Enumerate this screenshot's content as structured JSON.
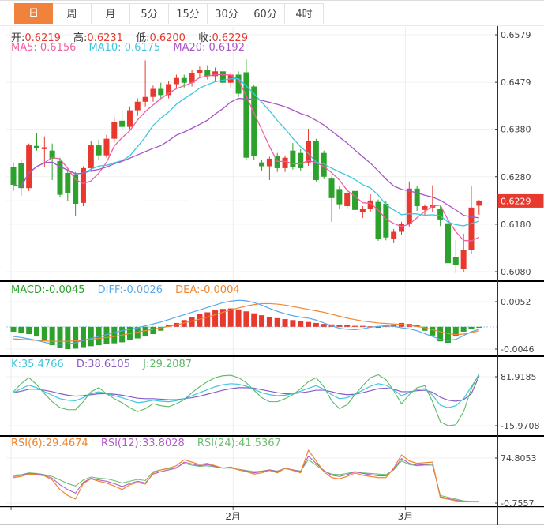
{
  "tabs": {
    "items": [
      {
        "label": "日",
        "active": true
      },
      {
        "label": "周",
        "active": false
      },
      {
        "label": "月",
        "active": false
      },
      {
        "label": "5分",
        "active": false
      },
      {
        "label": "15分",
        "active": false
      },
      {
        "label": "30分",
        "active": false
      },
      {
        "label": "60分",
        "active": false
      },
      {
        "label": "4时",
        "active": false
      }
    ]
  },
  "legend": {
    "main": {
      "open_label": "开:",
      "open_value": "0.6219",
      "high_label": "高:",
      "high_value": "0.6231",
      "low_label": "低:",
      "low_value": "0.6200",
      "close_label": "收:",
      "close_value": "0.6229",
      "ma5": "MA5: 0.6156",
      "ma10": "MA10: 0.6175",
      "ma20": "MA20: 0.6192"
    },
    "macd": {
      "macd": "MACD:-0.0045",
      "diff": "DIFF:-0.0026",
      "dea": "DEA:-0.0004"
    },
    "kdj": {
      "k": "K:35.4766",
      "d": "D:38.6105",
      "j": "J:29.2087"
    },
    "rsi": {
      "rsi6": "RSI(6):29.4674",
      "rsi12": "RSI(12):33.8028",
      "rsi24": "RSI(24):41.5367"
    }
  },
  "colors": {
    "accent_orange": "#f0823c",
    "up_red": "#e8392f",
    "down_green": "#2ca12c",
    "ma5_pink": "#f05fa0",
    "ma10_cyan": "#3ec6e0",
    "ma20_purple": "#a855c8",
    "diff_blue": "#5aa8e8",
    "dea_orange": "#f0862e",
    "k_cyan": "#3ec6e0",
    "d_purple": "#8a5cc8",
    "j_green": "#5cb866",
    "rsi6_orange": "#f0862e",
    "rsi12_purple": "#b45cc8",
    "rsi24_green": "#6cbf70",
    "grid": "#f1f1f1",
    "axis": "#333333",
    "label": "#444444",
    "price_dotted": "#f2a6a6",
    "macd_zero_dotted": "#8fd4e8"
  },
  "chart_data": {
    "type": "candlestick",
    "panels": [
      "price+MA(5,10,20)",
      "MACD(hist,DIFF,DEA)",
      "KDJ",
      "RSI(6,12,24)"
    ],
    "x_axis": {
      "month_marks": [
        {
          "label": "",
          "index": -0.3
        },
        {
          "label": "2月",
          "index": 28.3
        },
        {
          "label": "3月",
          "index": 50.5
        }
      ]
    },
    "main": {
      "y_ticks": [
        0.6579,
        0.6479,
        0.638,
        0.628,
        0.618,
        0.608
      ],
      "current_price": 0.6229,
      "current_price_label": "0.6229",
      "ma_periods": [
        5,
        10,
        20
      ],
      "candles": [
        [
          0.63,
          0.631,
          0.625,
          0.6263
        ],
        [
          0.6308,
          0.6315,
          0.624,
          0.6256
        ],
        [
          0.6256,
          0.635,
          0.625,
          0.6346
        ],
        [
          0.6345,
          0.6372,
          0.6335,
          0.634
        ],
        [
          0.6338,
          0.6365,
          0.63,
          0.6342
        ],
        [
          0.6335,
          0.635,
          0.6273,
          0.6318
        ],
        [
          0.6313,
          0.632,
          0.6238,
          0.6242
        ],
        [
          0.6288,
          0.6292,
          0.6228,
          0.6246
        ],
        [
          0.6285,
          0.629,
          0.6198,
          0.6223
        ],
        [
          0.6225,
          0.6302,
          0.6218,
          0.6298
        ],
        [
          0.6298,
          0.6355,
          0.629,
          0.6346
        ],
        [
          0.6346,
          0.6358,
          0.6315,
          0.6325
        ],
        [
          0.6325,
          0.6368,
          0.632,
          0.636
        ],
        [
          0.636,
          0.6405,
          0.6352,
          0.6395
        ],
        [
          0.6398,
          0.642,
          0.6378,
          0.6385
        ],
        [
          0.6385,
          0.6428,
          0.638,
          0.642
        ],
        [
          0.642,
          0.6445,
          0.6408,
          0.6438
        ],
        [
          0.6438,
          0.6525,
          0.6428,
          0.6448
        ],
        [
          0.6448,
          0.6472,
          0.6438,
          0.6465
        ],
        [
          0.6465,
          0.6478,
          0.6445,
          0.6452
        ],
        [
          0.6452,
          0.6482,
          0.6445,
          0.6475
        ],
        [
          0.6475,
          0.6495,
          0.6465,
          0.6488
        ],
        [
          0.6488,
          0.6495,
          0.6468,
          0.6478
        ],
        [
          0.6478,
          0.6505,
          0.647,
          0.6498
        ],
        [
          0.6498,
          0.6512,
          0.6488,
          0.6505
        ],
        [
          0.6505,
          0.6515,
          0.6485,
          0.6492
        ],
        [
          0.6492,
          0.651,
          0.6482,
          0.6502
        ],
        [
          0.6502,
          0.6508,
          0.647,
          0.6478
        ],
        [
          0.6478,
          0.65,
          0.6468,
          0.6495
        ],
        [
          0.6495,
          0.6502,
          0.6448,
          0.6455
        ],
        [
          0.65,
          0.6527,
          0.6315,
          0.632
        ],
        [
          0.647,
          0.6473,
          0.6316,
          0.6323
        ],
        [
          0.631,
          0.6315,
          0.6293,
          0.6302
        ],
        [
          0.6302,
          0.6322,
          0.6273,
          0.6318
        ],
        [
          0.6323,
          0.633,
          0.629,
          0.6298
        ],
        [
          0.6298,
          0.6325,
          0.629,
          0.632
        ],
        [
          0.6335,
          0.6351,
          0.6295,
          0.63
        ],
        [
          0.633,
          0.6338,
          0.6292,
          0.6298
        ],
        [
          0.631,
          0.6381,
          0.6303,
          0.6356
        ],
        [
          0.6356,
          0.636,
          0.627,
          0.6273
        ],
        [
          0.633,
          0.6335,
          0.6275,
          0.628
        ],
        [
          0.6276,
          0.628,
          0.6185,
          0.6235
        ],
        [
          0.6254,
          0.626,
          0.6213,
          0.6222
        ],
        [
          0.6218,
          0.625,
          0.6212,
          0.6246
        ],
        [
          0.625,
          0.6255,
          0.6164,
          0.621
        ],
        [
          0.6205,
          0.6218,
          0.6193,
          0.6213
        ],
        [
          0.6213,
          0.6243,
          0.6205,
          0.623
        ],
        [
          0.6227,
          0.6232,
          0.6145,
          0.6149
        ],
        [
          0.6223,
          0.6228,
          0.6146,
          0.6152
        ],
        [
          0.6149,
          0.617,
          0.614,
          0.6164
        ],
        [
          0.6164,
          0.6185,
          0.6158,
          0.618
        ],
        [
          0.618,
          0.627,
          0.6175,
          0.6255
        ],
        [
          0.6255,
          0.626,
          0.6208,
          0.6218
        ],
        [
          0.621,
          0.6222,
          0.6198,
          0.6218
        ],
        [
          0.6215,
          0.6262,
          0.6206,
          0.622
        ],
        [
          0.6212,
          0.6218,
          0.6176,
          0.619
        ],
        [
          0.6182,
          0.6186,
          0.6085,
          0.6098
        ],
        [
          0.611,
          0.6147,
          0.6077,
          0.6095
        ],
        [
          0.6085,
          0.616,
          0.608,
          0.6126
        ],
        [
          0.6126,
          0.626,
          0.6118,
          0.6215
        ],
        [
          0.6219,
          0.6231,
          0.62,
          0.6229
        ]
      ]
    },
    "macd": {
      "y_ticks": [
        0.0052,
        -0.0046
      ],
      "unit": 0.0001,
      "hist": [
        -10,
        -12,
        -15,
        -20,
        -28,
        -38,
        -44,
        -46,
        -45,
        -42,
        -40,
        -38,
        -36,
        -34,
        -32,
        -28,
        -24,
        -20,
        -15,
        -8,
        3,
        8,
        14,
        20,
        26,
        30,
        34,
        37,
        38,
        36,
        32,
        28,
        24,
        21,
        18,
        16,
        14,
        12,
        10,
        8,
        6,
        5,
        4,
        3,
        2,
        2,
        1,
        -2,
        3,
        5,
        8,
        6,
        3,
        -8,
        -18,
        -30,
        -33,
        -20,
        -10,
        -5,
        -2
      ],
      "diff": [
        -20,
        -22,
        -25,
        -28,
        -32,
        -35,
        -36,
        -35,
        -33,
        -28,
        -24,
        -20,
        -16,
        -12,
        -8,
        -5,
        -2,
        2,
        6,
        10,
        15,
        20,
        25,
        30,
        35,
        40,
        45,
        50,
        53,
        55,
        54,
        50,
        45,
        38,
        32,
        27,
        23,
        20,
        18,
        14,
        8,
        2,
        -3,
        -5,
        -6,
        -4,
        -1,
        1,
        2,
        1,
        -2,
        -4,
        -8,
        -14,
        -20,
        -26,
        -28,
        -26,
        -18,
        -10,
        -5
      ],
      "dea": [
        -25,
        -26,
        -27,
        -28,
        -29,
        -30,
        -30,
        -30,
        -29,
        -28,
        -26,
        -24,
        -22,
        -20,
        -17,
        -14,
        -11,
        -8,
        -5,
        -2,
        1,
        4,
        8,
        12,
        16,
        20,
        25,
        30,
        35,
        39,
        43,
        46,
        48,
        48,
        47,
        45,
        42,
        39,
        36,
        33,
        30,
        26,
        22,
        18,
        15,
        12,
        10,
        8,
        7,
        6,
        5,
        3,
        1,
        -2,
        -6,
        -10,
        -14,
        -16,
        -15,
        -12,
        -8
      ]
    },
    "kdj": {
      "y_ticks": [
        81.9185,
        -15.9708
      ],
      "k": [
        50,
        58,
        65,
        60,
        52,
        45,
        38,
        35,
        34,
        40,
        48,
        52,
        48,
        44,
        40,
        35,
        30,
        32,
        35,
        33,
        32,
        34,
        38,
        44,
        50,
        56,
        62,
        66,
        68,
        67,
        63,
        57,
        50,
        46,
        44,
        45,
        48,
        53,
        59,
        64,
        57,
        46,
        38,
        40,
        47,
        55,
        63,
        68,
        65,
        56,
        44,
        50,
        56,
        58,
        45,
        25,
        20,
        24,
        38,
        62,
        85
      ],
      "d": [
        50,
        53,
        57,
        57,
        55,
        52,
        48,
        45,
        43,
        44,
        46,
        48,
        48,
        47,
        45,
        42,
        39,
        38,
        38,
        37,
        36,
        36,
        38,
        40,
        43,
        47,
        51,
        55,
        58,
        60,
        60,
        59,
        56,
        53,
        50,
        48,
        48,
        50,
        52,
        55,
        55,
        52,
        48,
        46,
        47,
        50,
        54,
        58,
        59,
        57,
        52,
        52,
        54,
        55,
        51,
        41,
        35,
        33,
        36,
        48,
        83
      ],
      "j": [
        52,
        68,
        80,
        66,
        48,
        32,
        20,
        16,
        16,
        32,
        52,
        60,
        48,
        38,
        30,
        20,
        12,
        18,
        28,
        24,
        22,
        28,
        36,
        50,
        62,
        72,
        80,
        84,
        85,
        80,
        70,
        55,
        40,
        32,
        32,
        38,
        46,
        58,
        72,
        80,
        62,
        34,
        18,
        26,
        46,
        64,
        80,
        86,
        76,
        54,
        28,
        46,
        60,
        64,
        32,
        -8,
        -16,
        -14,
        12,
        58,
        88
      ]
    },
    "rsi": {
      "y_ticks": [
        74.8053,
        -0.7557
      ],
      "rsi6": [
        42,
        44,
        48,
        47,
        45,
        38,
        22,
        12,
        6,
        32,
        40,
        36,
        33,
        28,
        22,
        30,
        34,
        31,
        50,
        55,
        58,
        62,
        72,
        68,
        64,
        66,
        62,
        58,
        60,
        55,
        52,
        48,
        50,
        54,
        50,
        58,
        54,
        50,
        88,
        70,
        52,
        42,
        40,
        44,
        50,
        46,
        44,
        42,
        42,
        58,
        80,
        70,
        66,
        67,
        68,
        8,
        6,
        3,
        2,
        2,
        2
      ],
      "rsi12": [
        44,
        46,
        49,
        48,
        46,
        41,
        30,
        22,
        16,
        34,
        41,
        38,
        36,
        32,
        27,
        32,
        36,
        33,
        48,
        52,
        55,
        58,
        68,
        65,
        62,
        64,
        61,
        58,
        59,
        55,
        53,
        50,
        52,
        55,
        52,
        58,
        55,
        52,
        78,
        66,
        54,
        46,
        44,
        47,
        52,
        49,
        47,
        45,
        45,
        56,
        74,
        66,
        63,
        64,
        65,
        10,
        7,
        4,
        2,
        2,
        2
      ],
      "rsi24": [
        46,
        47,
        50,
        49,
        47,
        44,
        38,
        32,
        28,
        38,
        43,
        41,
        40,
        37,
        33,
        36,
        39,
        37,
        52,
        55,
        57,
        59,
        66,
        63,
        61,
        62,
        60,
        58,
        58,
        56,
        54,
        52,
        53,
        55,
        53,
        57,
        55,
        53,
        72,
        63,
        53,
        48,
        47,
        49,
        52,
        50,
        49,
        48,
        47,
        55,
        70,
        64,
        62,
        63,
        63,
        12,
        9,
        6,
        3,
        2,
        2
      ]
    }
  }
}
